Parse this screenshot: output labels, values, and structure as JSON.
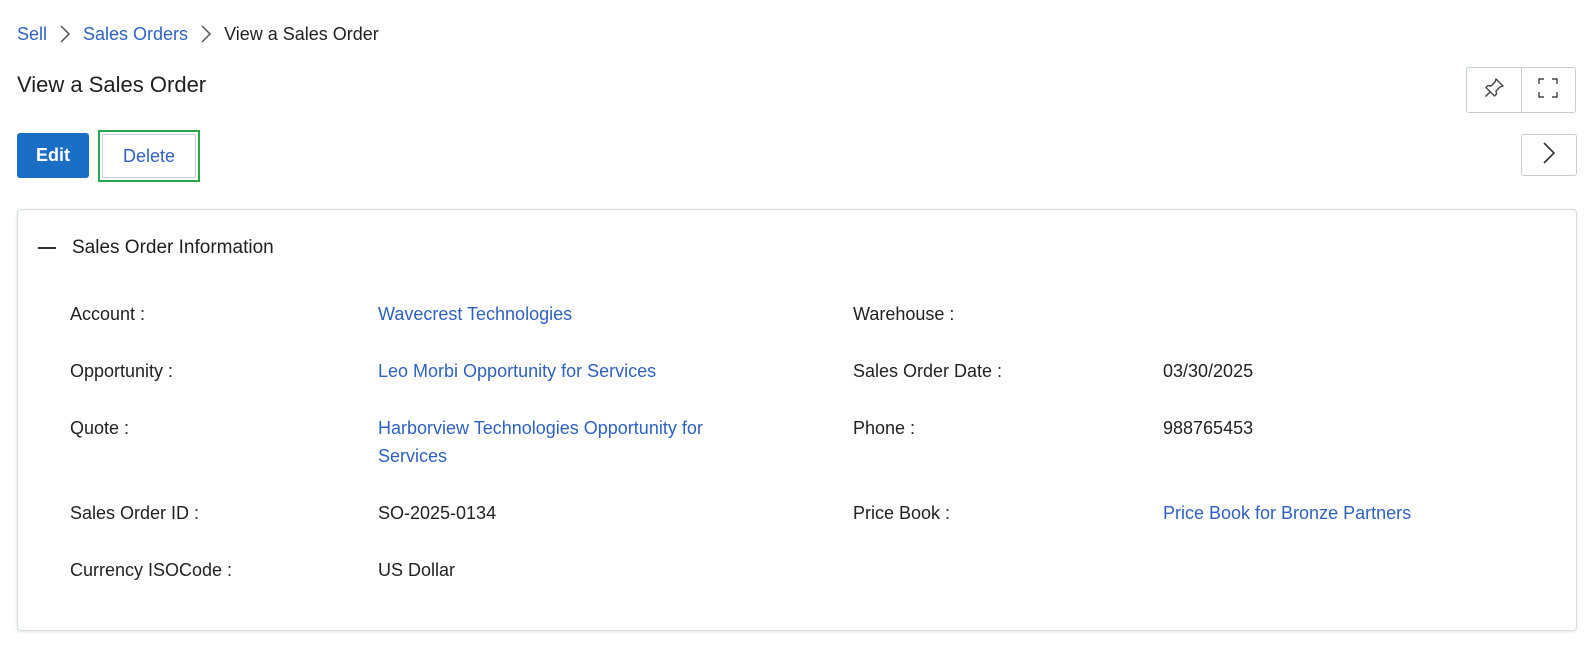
{
  "breadcrumb": {
    "items": [
      "Sell",
      "Sales Orders"
    ],
    "current": "View a Sales Order"
  },
  "page": {
    "title": "View a Sales Order"
  },
  "actions": {
    "edit_label": "Edit",
    "delete_label": "Delete"
  },
  "section": {
    "title": "Sales Order Information"
  },
  "fields": {
    "account": {
      "label": "Account :",
      "value": "Wavecrest Technologies"
    },
    "opportunity": {
      "label": "Opportunity :",
      "value": "Leo Morbi Opportunity for Services"
    },
    "quote": {
      "label": "Quote :",
      "value_line1": "Harborview Technologies Opportunity for",
      "value_line2": "Services"
    },
    "sales_order_id": {
      "label": "Sales Order ID :",
      "value": "SO-2025-0134"
    },
    "currency": {
      "label": "Currency ISOCode :",
      "value": "US Dollar"
    },
    "warehouse": {
      "label": "Warehouse :",
      "value": ""
    },
    "sales_order_date": {
      "label": "Sales Order Date :",
      "value": "03/30/2025"
    },
    "phone": {
      "label": "Phone :",
      "value": "988765453"
    },
    "price_book": {
      "label": "Price Book :",
      "value": "Price Book for Bronze Partners"
    }
  },
  "colors": {
    "link": "#2f62bf",
    "primary": "#1a6fc4",
    "highlight": "#26a84a"
  },
  "icons": [
    "chevron-right-icon",
    "pin-icon",
    "fullscreen-icon",
    "collapse-icon"
  ]
}
